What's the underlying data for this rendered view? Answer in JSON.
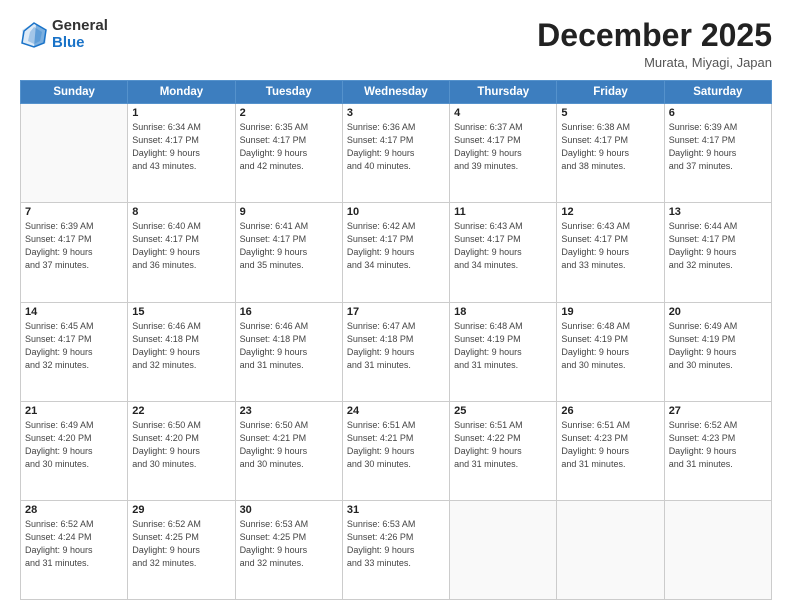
{
  "header": {
    "logo_general": "General",
    "logo_blue": "Blue",
    "title": "December 2025",
    "location": "Murata, Miyagi, Japan"
  },
  "weekdays": [
    "Sunday",
    "Monday",
    "Tuesday",
    "Wednesday",
    "Thursday",
    "Friday",
    "Saturday"
  ],
  "weeks": [
    [
      {
        "day": "",
        "info": ""
      },
      {
        "day": "1",
        "info": "Sunrise: 6:34 AM\nSunset: 4:17 PM\nDaylight: 9 hours\nand 43 minutes."
      },
      {
        "day": "2",
        "info": "Sunrise: 6:35 AM\nSunset: 4:17 PM\nDaylight: 9 hours\nand 42 minutes."
      },
      {
        "day": "3",
        "info": "Sunrise: 6:36 AM\nSunset: 4:17 PM\nDaylight: 9 hours\nand 40 minutes."
      },
      {
        "day": "4",
        "info": "Sunrise: 6:37 AM\nSunset: 4:17 PM\nDaylight: 9 hours\nand 39 minutes."
      },
      {
        "day": "5",
        "info": "Sunrise: 6:38 AM\nSunset: 4:17 PM\nDaylight: 9 hours\nand 38 minutes."
      },
      {
        "day": "6",
        "info": "Sunrise: 6:39 AM\nSunset: 4:17 PM\nDaylight: 9 hours\nand 37 minutes."
      }
    ],
    [
      {
        "day": "7",
        "info": "Sunrise: 6:39 AM\nSunset: 4:17 PM\nDaylight: 9 hours\nand 37 minutes."
      },
      {
        "day": "8",
        "info": "Sunrise: 6:40 AM\nSunset: 4:17 PM\nDaylight: 9 hours\nand 36 minutes."
      },
      {
        "day": "9",
        "info": "Sunrise: 6:41 AM\nSunset: 4:17 PM\nDaylight: 9 hours\nand 35 minutes."
      },
      {
        "day": "10",
        "info": "Sunrise: 6:42 AM\nSunset: 4:17 PM\nDaylight: 9 hours\nand 34 minutes."
      },
      {
        "day": "11",
        "info": "Sunrise: 6:43 AM\nSunset: 4:17 PM\nDaylight: 9 hours\nand 34 minutes."
      },
      {
        "day": "12",
        "info": "Sunrise: 6:43 AM\nSunset: 4:17 PM\nDaylight: 9 hours\nand 33 minutes."
      },
      {
        "day": "13",
        "info": "Sunrise: 6:44 AM\nSunset: 4:17 PM\nDaylight: 9 hours\nand 32 minutes."
      }
    ],
    [
      {
        "day": "14",
        "info": "Sunrise: 6:45 AM\nSunset: 4:17 PM\nDaylight: 9 hours\nand 32 minutes."
      },
      {
        "day": "15",
        "info": "Sunrise: 6:46 AM\nSunset: 4:18 PM\nDaylight: 9 hours\nand 32 minutes."
      },
      {
        "day": "16",
        "info": "Sunrise: 6:46 AM\nSunset: 4:18 PM\nDaylight: 9 hours\nand 31 minutes."
      },
      {
        "day": "17",
        "info": "Sunrise: 6:47 AM\nSunset: 4:18 PM\nDaylight: 9 hours\nand 31 minutes."
      },
      {
        "day": "18",
        "info": "Sunrise: 6:48 AM\nSunset: 4:19 PM\nDaylight: 9 hours\nand 31 minutes."
      },
      {
        "day": "19",
        "info": "Sunrise: 6:48 AM\nSunset: 4:19 PM\nDaylight: 9 hours\nand 30 minutes."
      },
      {
        "day": "20",
        "info": "Sunrise: 6:49 AM\nSunset: 4:19 PM\nDaylight: 9 hours\nand 30 minutes."
      }
    ],
    [
      {
        "day": "21",
        "info": "Sunrise: 6:49 AM\nSunset: 4:20 PM\nDaylight: 9 hours\nand 30 minutes."
      },
      {
        "day": "22",
        "info": "Sunrise: 6:50 AM\nSunset: 4:20 PM\nDaylight: 9 hours\nand 30 minutes."
      },
      {
        "day": "23",
        "info": "Sunrise: 6:50 AM\nSunset: 4:21 PM\nDaylight: 9 hours\nand 30 minutes."
      },
      {
        "day": "24",
        "info": "Sunrise: 6:51 AM\nSunset: 4:21 PM\nDaylight: 9 hours\nand 30 minutes."
      },
      {
        "day": "25",
        "info": "Sunrise: 6:51 AM\nSunset: 4:22 PM\nDaylight: 9 hours\nand 31 minutes."
      },
      {
        "day": "26",
        "info": "Sunrise: 6:51 AM\nSunset: 4:23 PM\nDaylight: 9 hours\nand 31 minutes."
      },
      {
        "day": "27",
        "info": "Sunrise: 6:52 AM\nSunset: 4:23 PM\nDaylight: 9 hours\nand 31 minutes."
      }
    ],
    [
      {
        "day": "28",
        "info": "Sunrise: 6:52 AM\nSunset: 4:24 PM\nDaylight: 9 hours\nand 31 minutes."
      },
      {
        "day": "29",
        "info": "Sunrise: 6:52 AM\nSunset: 4:25 PM\nDaylight: 9 hours\nand 32 minutes."
      },
      {
        "day": "30",
        "info": "Sunrise: 6:53 AM\nSunset: 4:25 PM\nDaylight: 9 hours\nand 32 minutes."
      },
      {
        "day": "31",
        "info": "Sunrise: 6:53 AM\nSunset: 4:26 PM\nDaylight: 9 hours\nand 33 minutes."
      },
      {
        "day": "",
        "info": ""
      },
      {
        "day": "",
        "info": ""
      },
      {
        "day": "",
        "info": ""
      }
    ]
  ]
}
